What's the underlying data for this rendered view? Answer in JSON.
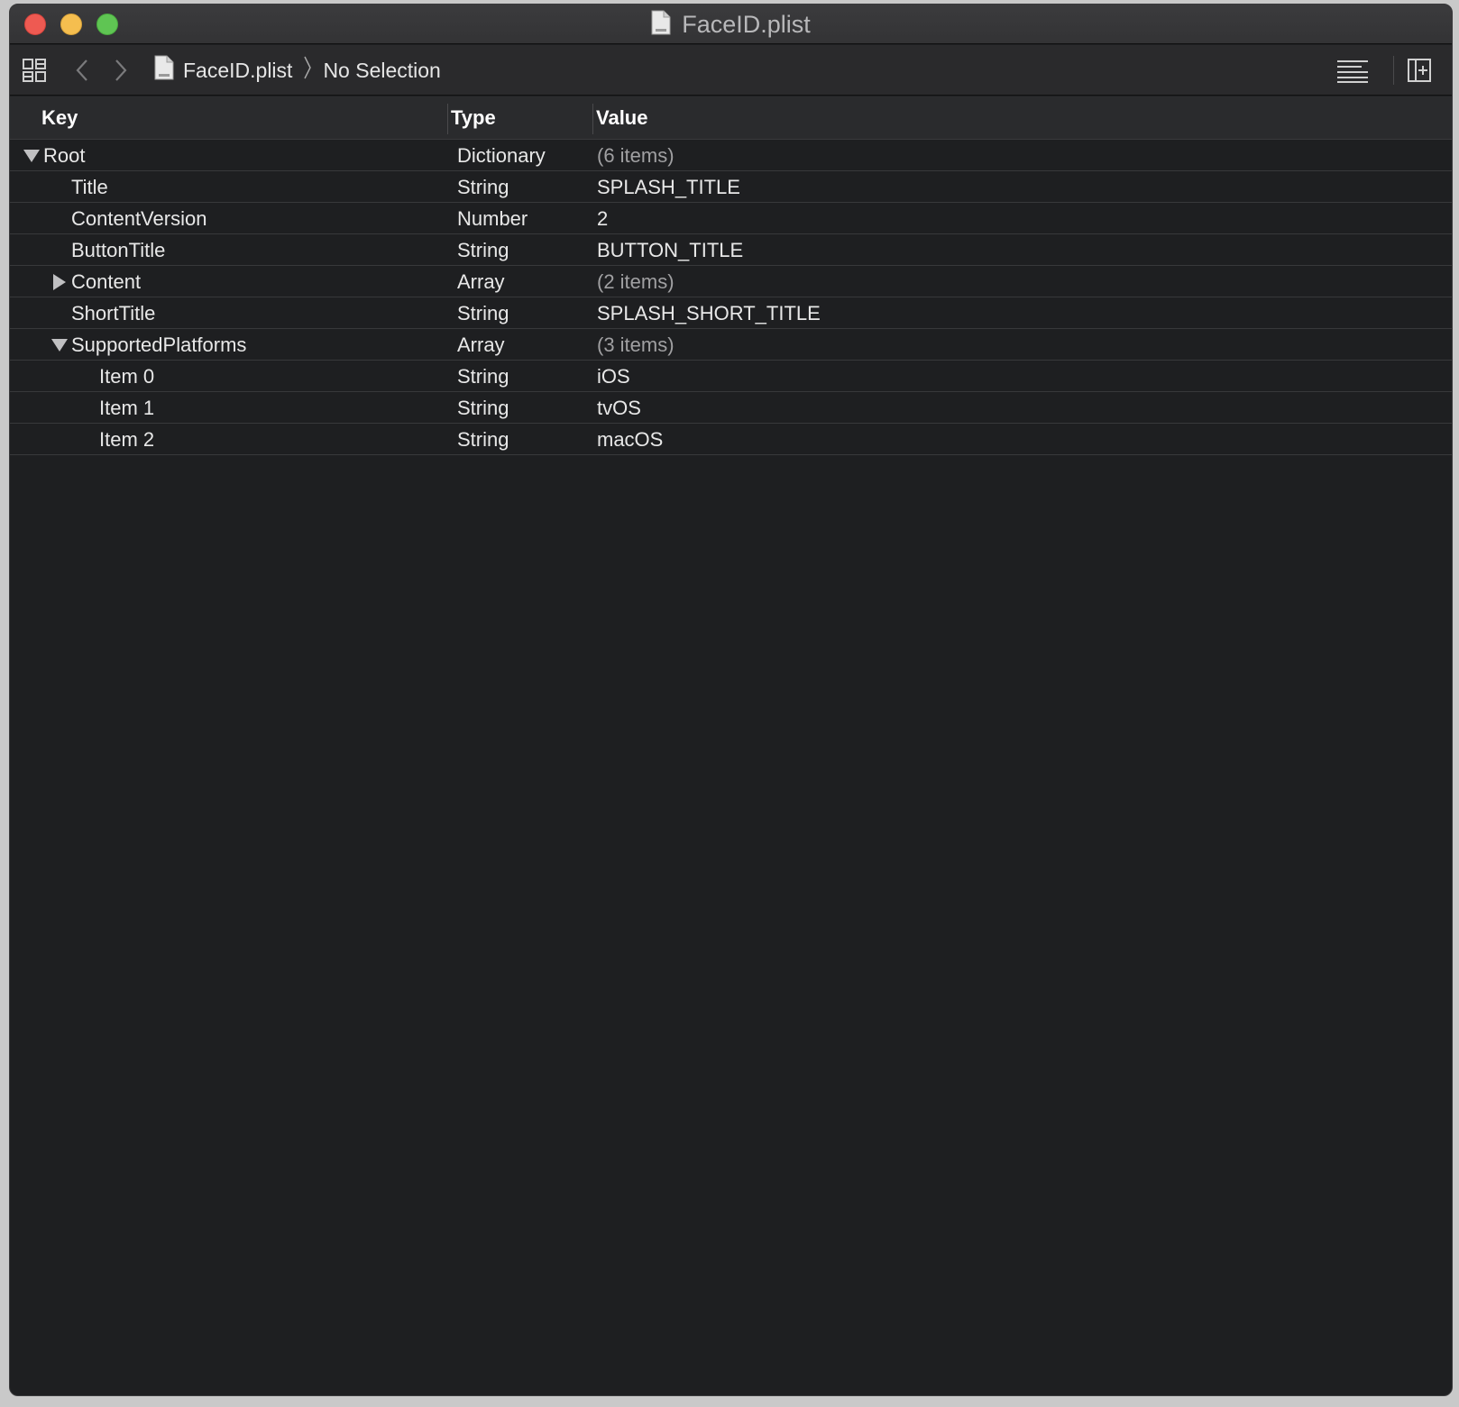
{
  "window": {
    "title": "FaceID.plist",
    "icons": [
      "close-button",
      "minimize-button",
      "zoom-button",
      "plist-file-icon"
    ]
  },
  "toolbar": {
    "breadcrumb_file": "FaceID.plist",
    "breadcrumb_selection": "No Selection",
    "icons": [
      "related-items-icon",
      "back-arrow-icon",
      "forward-arrow-icon",
      "plist-file-icon",
      "editor-options-icon",
      "add-editor-icon"
    ]
  },
  "table": {
    "headers": {
      "key": "Key",
      "type": "Type",
      "value": "Value"
    },
    "rows": [
      {
        "key": "Root",
        "type": "Dictionary",
        "value": "(6 items)"
      },
      {
        "key": "Title",
        "type": "String",
        "value": "SPLASH_TITLE"
      },
      {
        "key": "ContentVersion",
        "type": "Number",
        "value": "2"
      },
      {
        "key": "ButtonTitle",
        "type": "String",
        "value": "BUTTON_TITLE"
      },
      {
        "key": "Content",
        "type": "Array",
        "value": "(2 items)"
      },
      {
        "key": "ShortTitle",
        "type": "String",
        "value": "SPLASH_SHORT_TITLE"
      },
      {
        "key": "SupportedPlatforms",
        "type": "Array",
        "value": "(3 items)"
      },
      {
        "key": "Item 0",
        "type": "String",
        "value": "iOS"
      },
      {
        "key": "Item 1",
        "type": "String",
        "value": "tvOS"
      },
      {
        "key": "Item 2",
        "type": "String",
        "value": "macOS"
      }
    ]
  },
  "colors": {
    "background": "#1e1f21",
    "toolbar": "#2a2a2c",
    "close": "#ee5a52",
    "minimize": "#f5be4f",
    "zoom": "#5fc553"
  }
}
